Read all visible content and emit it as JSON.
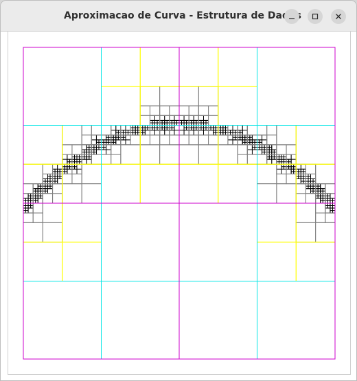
{
  "window": {
    "title": "Aproximacao de Curva - Estrutura de Dados"
  },
  "controls": {
    "minimize_icon": "minimize-icon",
    "maximize_icon": "maximize-icon",
    "close_icon": "close-icon"
  },
  "curve": {
    "type": "parabola",
    "max_depth": 7
  },
  "colors": {
    "level_1": "#cc00cc",
    "level_2": "#00e5e5",
    "level_3": "#ffff00",
    "deep": "#000000",
    "fine": "#808080"
  }
}
